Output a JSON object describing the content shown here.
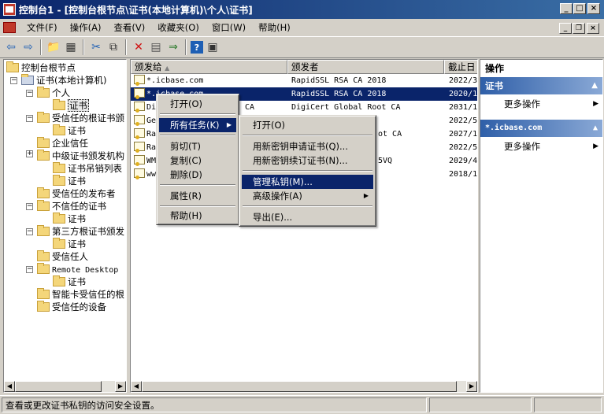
{
  "window": {
    "title": "控制台1 - [控制台根节点\\证书(本地计算机)\\个人\\证书]"
  },
  "menu": [
    "文件(F)",
    "操作(A)",
    "查看(V)",
    "收藏夹(O)",
    "窗口(W)",
    "帮助(H)"
  ],
  "toolbar": [
    "back-icon",
    "forward-icon",
    "up-folder-icon",
    "show-tree-icon",
    "cut-icon",
    "copy-icon",
    "delete-icon",
    "properties-icon",
    "export-icon",
    "help-icon",
    "console-icon"
  ],
  "tree": {
    "root": "控制台根节点",
    "items": [
      "证书(本地计算机)",
      "个人",
      "证书",
      "受信任的根证书颁",
      "证书",
      "企业信任",
      "中级证书颁发机构",
      "证书吊销列表",
      "证书",
      "受信任的发布者",
      "不信任的证书",
      "证书",
      "第三方根证书颁发",
      "证书",
      "受信任人",
      "Remote Desktop",
      "证书",
      "智能卡受信任的根",
      "受信任的设备"
    ]
  },
  "list": {
    "columns": [
      "颁发给",
      "颁发者",
      "截止日"
    ],
    "rows": [
      {
        "issued_to": "*.icbase.com",
        "issuer": "RapidSSL RSA CA 2018",
        "expires": "2022/3"
      },
      {
        "issued_to": "*.icbase.com",
        "issuer": "RapidSSL RSA CA 2018",
        "expires": "2020/1"
      },
      {
        "issued_to": "Di",
        "issuer": "DigiCert Global Root CA",
        "expires": "2031/1",
        "issuer_prefix": "CA"
      },
      {
        "issued_to": "Ge",
        "issuer": "",
        "expires": "2022/5"
      },
      {
        "issued_to": "Ra",
        "issuer": "ot CA",
        "expires": "2027/1"
      },
      {
        "issued_to": "Ra",
        "issuer": "",
        "expires": "2022/5"
      },
      {
        "issued_to": "WM",
        "issuer": "5VQ",
        "expires": "2029/4"
      },
      {
        "issued_to": "ww",
        "issuer": "",
        "expires": "2018/1"
      }
    ]
  },
  "context_menu": {
    "items": [
      "打开(O)",
      "所有任务(K)",
      "剪切(T)",
      "复制(C)",
      "删除(D)",
      "属性(R)",
      "帮助(H)"
    ]
  },
  "submenu": {
    "items": [
      "打开(O)",
      "用新密钥申请证书(Q)...",
      "用新密钥续订证书(N)...",
      "管理私钥(M)...",
      "高级操作(A)",
      "导出(E)..."
    ]
  },
  "actions": {
    "title": "操作",
    "sections": [
      {
        "label": "证书",
        "item": "更多操作"
      },
      {
        "label": "*.icbase.com",
        "item": "更多操作"
      }
    ]
  },
  "status": {
    "text": "查看或更改证书私钥的访问安全设置。"
  }
}
